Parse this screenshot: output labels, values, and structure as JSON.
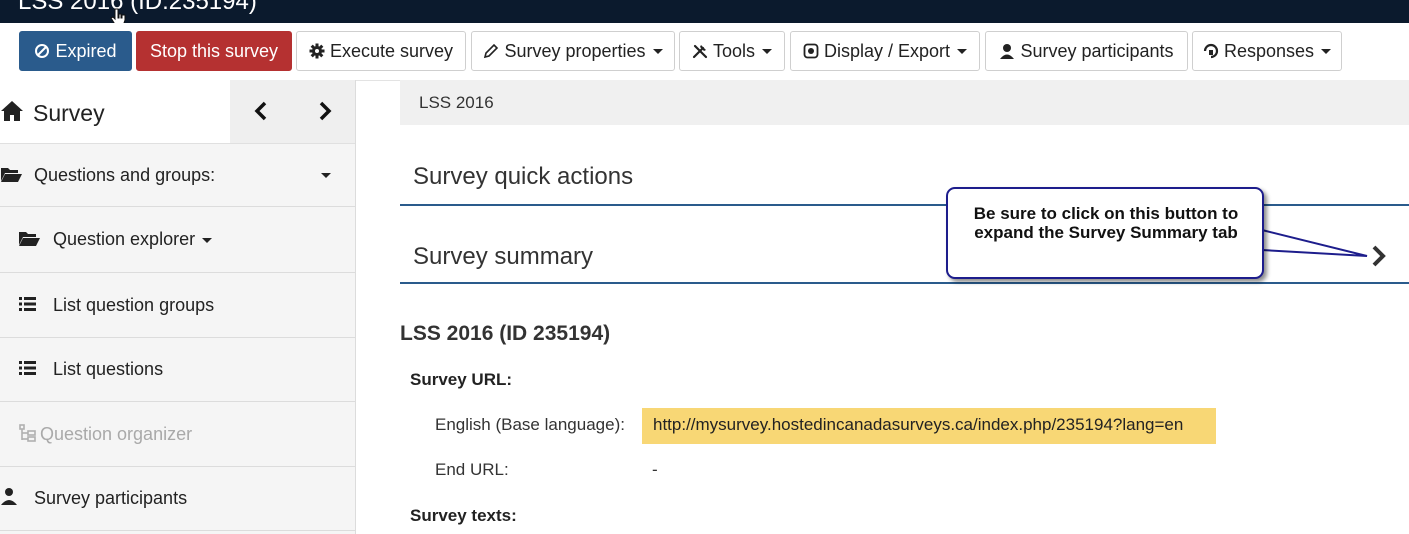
{
  "window": {
    "title": "LSS 2016 (ID:235194)"
  },
  "toolbar": {
    "expired_label": "Expired",
    "stop_label": "Stop this survey",
    "execute_label": "Execute survey",
    "properties_label": "Survey properties",
    "tools_label": "Tools",
    "display_label": "Display / Export",
    "participants_label": "Survey participants",
    "responses_label": "Responses"
  },
  "sidebar": {
    "header": "Survey",
    "items": [
      {
        "label": "Questions and groups:"
      },
      {
        "label": "Question explorer"
      },
      {
        "label": "List question groups"
      },
      {
        "label": "List questions"
      },
      {
        "label": "Question organizer"
      },
      {
        "label": "Survey participants"
      }
    ]
  },
  "breadcrumb": "LSS 2016",
  "panels": {
    "quick_actions": "Survey quick actions",
    "summary": "Survey summary"
  },
  "callout": {
    "text": "Be sure to click on this button to expand the Survey Summary tab"
  },
  "summary": {
    "heading": "LSS 2016 (ID 235194)",
    "survey_url_label": "Survey URL:",
    "english_label": "English (Base language):",
    "english_url": "http://mysurvey.hostedincanadasurveys.ca/index.php/235194?lang=en",
    "end_url_label": "End URL:",
    "end_url_value": "-",
    "survey_texts_label": "Survey texts:"
  },
  "colors": {
    "brand_blue": "#2a5b8c",
    "stop_red": "#b53131",
    "url_highlight": "#f8d775",
    "topbar": "#0b1a2d"
  }
}
